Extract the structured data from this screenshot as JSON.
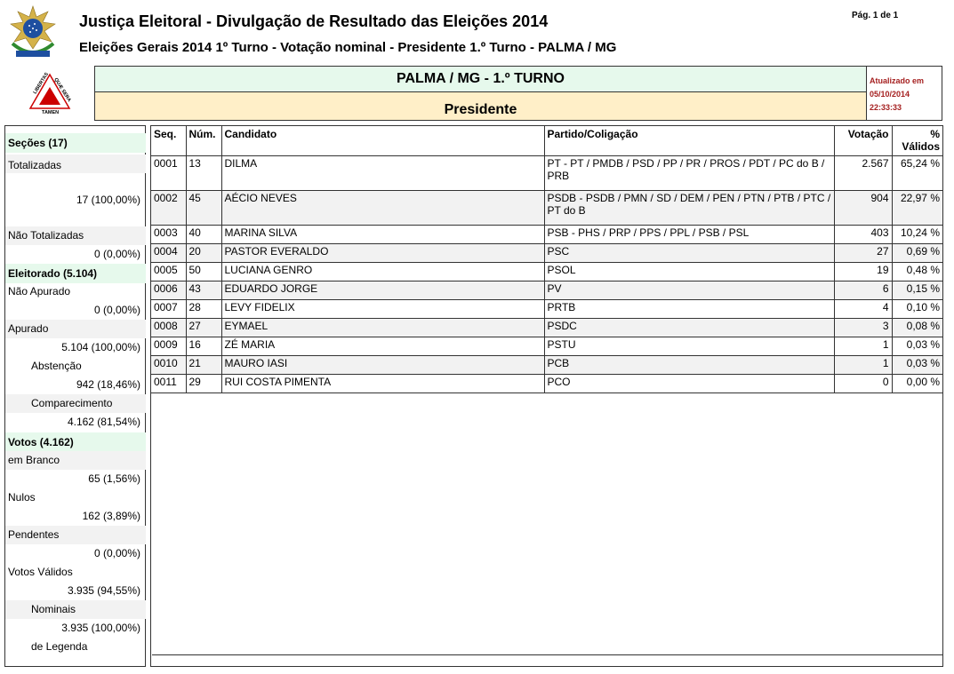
{
  "header": {
    "title": "Justiça Eleitoral - Divulgação de Resultado das Eleições 2014",
    "subtitle": "Eleições Gerais 2014 1º Turno - Votação nominal - Presidente 1.º Turno - PALMA / MG",
    "page": "Pág. 1 de 1"
  },
  "logo": {
    "text1": "LIBERTAS",
    "text2": "QUÆ SERA",
    "text3": "TAMEN"
  },
  "banner": {
    "location": "PALMA / MG - 1.º TURNO",
    "office": "Presidente"
  },
  "updated": {
    "label": "Atualizado em",
    "date": "05/10/2014",
    "time": "22:33:33"
  },
  "sidebar": {
    "secoes_title": "Seções  (17)",
    "totalizadas_label": "Totalizadas",
    "totalizadas_value": "17 (100,00%)",
    "nao_totalizadas_label": "Não Totalizadas",
    "nao_totalizadas_value": "0 (0,00%)",
    "eleitorado_title": "Eleitorado  (5.104)",
    "nao_apurado_label": "Não Apurado",
    "nao_apurado_value": "0 (0,00%)",
    "apurado_label": "Apurado",
    "apurado_value": "5.104 (100,00%)",
    "abstencao_label": "Abstenção",
    "abstencao_value": "942 (18,46%)",
    "comparecimento_label": "Comparecimento",
    "comparecimento_value": "4.162 (81,54%)",
    "votos_title": "Votos  (4.162)",
    "branco_label": "em Branco",
    "branco_value": "65 (1,56%)",
    "nulos_label": "Nulos",
    "nulos_value": "162 (3,89%)",
    "pendentes_label": "Pendentes",
    "pendentes_value": "0 (0,00%)",
    "validos_label": "Votos Válidos",
    "validos_value": "3.935 (94,55%)",
    "nominais_label": "Nominais",
    "nominais_value": "3.935 (100,00%)",
    "legenda_label": "de Legenda"
  },
  "table": {
    "headers": {
      "seq": "Seq.",
      "num": "Núm.",
      "cand": "Candidato",
      "partido": "Partido/Coligação",
      "votacao": "Votação",
      "pct1": "%",
      "pct2": "Válidos"
    },
    "rows": [
      {
        "seq": "0001",
        "num": "13",
        "cand": "DILMA",
        "partido": "PT - PT / PMDB / PSD / PP / PR / PROS / PDT / PC do B / PRB",
        "votos": "2.567",
        "pct": "65,24 %"
      },
      {
        "seq": "0002",
        "num": "45",
        "cand": "AÉCIO NEVES",
        "partido": "PSDB - PSDB / PMN / SD / DEM / PEN / PTN / PTB / PTC / PT do B",
        "votos": "904",
        "pct": "22,97 %"
      },
      {
        "seq": "0003",
        "num": "40",
        "cand": "MARINA SILVA",
        "partido": "PSB - PHS / PRP / PPS / PPL / PSB / PSL",
        "votos": "403",
        "pct": "10,24 %"
      },
      {
        "seq": "0004",
        "num": "20",
        "cand": "PASTOR EVERALDO",
        "partido": "PSC",
        "votos": "27",
        "pct": "0,69 %"
      },
      {
        "seq": "0005",
        "num": "50",
        "cand": "LUCIANA GENRO",
        "partido": "PSOL",
        "votos": "19",
        "pct": "0,48 %"
      },
      {
        "seq": "0006",
        "num": "43",
        "cand": "EDUARDO JORGE",
        "partido": "PV",
        "votos": "6",
        "pct": "0,15 %"
      },
      {
        "seq": "0007",
        "num": "28",
        "cand": "LEVY FIDELIX",
        "partido": "PRTB",
        "votos": "4",
        "pct": "0,10 %"
      },
      {
        "seq": "0008",
        "num": "27",
        "cand": "EYMAEL",
        "partido": "PSDC",
        "votos": "3",
        "pct": "0,08 %"
      },
      {
        "seq": "0009",
        "num": "16",
        "cand": "ZÉ MARIA",
        "partido": "PSTU",
        "votos": "1",
        "pct": "0,03 %"
      },
      {
        "seq": "0010",
        "num": "21",
        "cand": "MAURO IASI",
        "partido": "PCB",
        "votos": "1",
        "pct": "0,03 %"
      },
      {
        "seq": "0011",
        "num": "29",
        "cand": "RUI COSTA PIMENTA",
        "partido": "PCO",
        "votos": "0",
        "pct": "0,00 %"
      }
    ]
  }
}
